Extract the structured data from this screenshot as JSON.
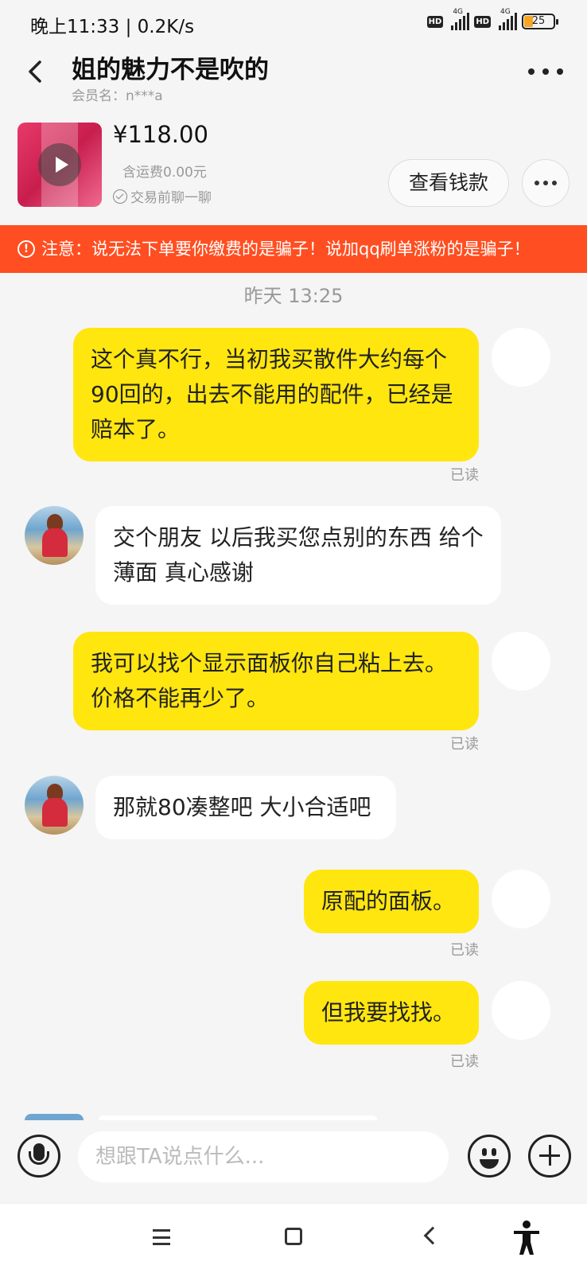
{
  "status": {
    "time": "晚上11:33 | 0.2K/s",
    "network_label": "4G",
    "hd_label": "HD",
    "battery": "25"
  },
  "header": {
    "title": "姐的魅力不是吹的",
    "member": "会员名：n***a"
  },
  "product": {
    "price": "¥118.00",
    "shipping": "含运费0.00元",
    "chat_hint": "交易前聊一聊",
    "view_button": "查看钱款"
  },
  "warning": {
    "icon": "!",
    "text": "注意：说无法下单要你缴费的是骗子！说加qq刷单涨粉的是骗子！"
  },
  "conversation": {
    "timestamp": "昨天 13:25",
    "messages": [
      {
        "from": "me",
        "text": "这个真不行，当初我买散件大约每个90回的，出去不能用的配件，已经是赔本了。",
        "status": "已读"
      },
      {
        "from": "other",
        "text": "交个朋友 以后我买您点别的东西 给个薄面 真心感谢"
      },
      {
        "from": "me",
        "text": "我可以找个显示面板你自己粘上去。价格不能再少了。",
        "status": "已读"
      },
      {
        "from": "other",
        "text": "那就80凑整吧 大小合适吧"
      },
      {
        "from": "me",
        "text": "原配的面板。",
        "status": "已读"
      },
      {
        "from": "me",
        "text": "但我要找找。",
        "status": "已读"
      }
    ]
  },
  "input": {
    "placeholder": "想跟TA说点什么..."
  },
  "colors": {
    "outgoing_bubble": "#ffe60f",
    "incoming_bubble": "#ffffff",
    "warning_bar": "#ff4e21",
    "background": "#f5f5f5"
  },
  "icons": {
    "back": "back-arrow-icon",
    "more": "more-dots-icon",
    "play": "play-icon",
    "check": "check-circle-icon",
    "mic": "microphone-icon",
    "emoji": "emoji-icon",
    "plus": "plus-icon"
  }
}
